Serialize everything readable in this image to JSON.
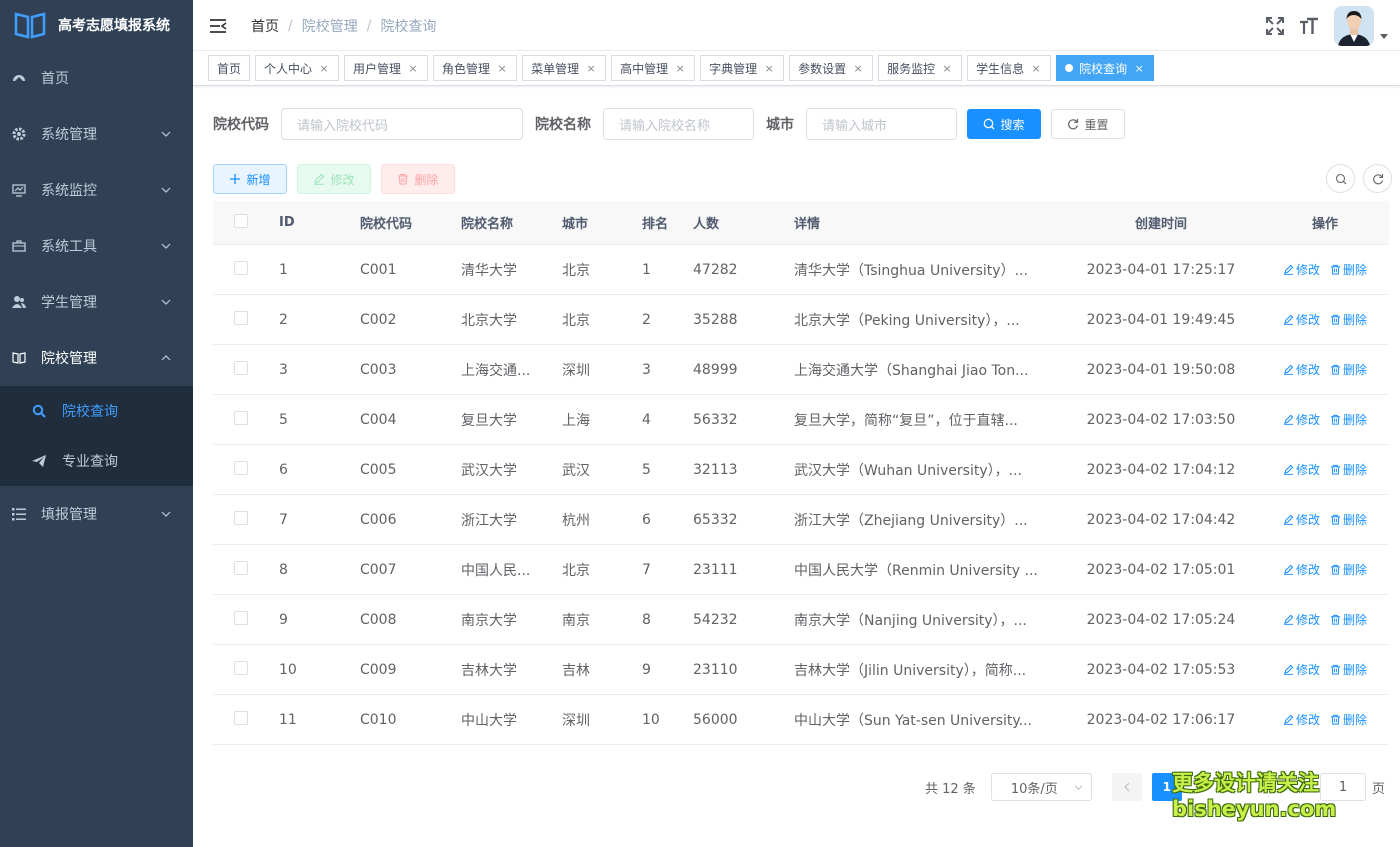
{
  "app": {
    "title": "高考志愿填报系统"
  },
  "sidebar": {
    "items": [
      {
        "label": "首页",
        "icon": "dashboard-icon"
      },
      {
        "label": "系统管理",
        "icon": "gear-icon"
      },
      {
        "label": "系统监控",
        "icon": "monitor-icon"
      },
      {
        "label": "系统工具",
        "icon": "toolbox-icon"
      },
      {
        "label": "学生管理",
        "icon": "people-icon"
      },
      {
        "label": "院校管理",
        "icon": "book-icon"
      },
      {
        "label": "填报管理",
        "icon": "list-icon"
      }
    ],
    "submenu": [
      {
        "label": "院校查询",
        "icon": "search-icon"
      },
      {
        "label": "专业查询",
        "icon": "send-icon"
      }
    ]
  },
  "navbar": {
    "breadcrumb": [
      "首页",
      "院校管理",
      "院校查询"
    ]
  },
  "tags": [
    {
      "label": "首页"
    },
    {
      "label": "个人中心"
    },
    {
      "label": "用户管理"
    },
    {
      "label": "角色管理"
    },
    {
      "label": "菜单管理"
    },
    {
      "label": "高中管理"
    },
    {
      "label": "字典管理"
    },
    {
      "label": "参数设置"
    },
    {
      "label": "服务监控"
    },
    {
      "label": "学生信息"
    },
    {
      "label": "院校查询"
    }
  ],
  "search": {
    "code_label": "院校代码",
    "code_placeholder": "请输入院校代码",
    "name_label": "院校名称",
    "name_placeholder": "请输入院校名称",
    "city_label": "城市",
    "city_placeholder": "请输入城市",
    "search_btn": "搜索",
    "reset_btn": "重置"
  },
  "toolbar": {
    "add": "新增",
    "edit": "修改",
    "delete": "删除"
  },
  "table": {
    "columns": [
      "ID",
      "院校代码",
      "院校名称",
      "城市",
      "排名",
      "人数",
      "详情",
      "创建时间",
      "操作"
    ],
    "op_edit": "修改",
    "op_delete": "删除",
    "rows": [
      {
        "id": "1",
        "code": "C001",
        "name": "清华大学",
        "city": "北京",
        "rank": "1",
        "count": "47282",
        "detail": "清华大学（Tsinghua University）...",
        "time": "2023-04-01 17:25:17"
      },
      {
        "id": "2",
        "code": "C002",
        "name": "北京大学",
        "city": "北京",
        "rank": "2",
        "count": "35288",
        "detail": "北京大学（Peking University），...",
        "time": "2023-04-01 19:49:45"
      },
      {
        "id": "3",
        "code": "C003",
        "name": "上海交通...",
        "city": "深圳",
        "rank": "3",
        "count": "48999",
        "detail": "上海交通大学（Shanghai Jiao Ton...",
        "time": "2023-04-01 19:50:08"
      },
      {
        "id": "5",
        "code": "C004",
        "name": "复旦大学",
        "city": "上海",
        "rank": "4",
        "count": "56332",
        "detail": "复旦大学，简称“复旦”，位于直辖...",
        "time": "2023-04-02 17:03:50"
      },
      {
        "id": "6",
        "code": "C005",
        "name": "武汉大学",
        "city": "武汉",
        "rank": "5",
        "count": "32113",
        "detail": "武汉大学（Wuhan University），...",
        "time": "2023-04-02 17:04:12"
      },
      {
        "id": "7",
        "code": "C006",
        "name": "浙江大学",
        "city": "杭州",
        "rank": "6",
        "count": "65332",
        "detail": "浙江大学（Zhejiang University）...",
        "time": "2023-04-02 17:04:42"
      },
      {
        "id": "8",
        "code": "C007",
        "name": "中国人民...",
        "city": "北京",
        "rank": "7",
        "count": "23111",
        "detail": "中国人民大学（Renmin University ...",
        "time": "2023-04-02 17:05:01"
      },
      {
        "id": "9",
        "code": "C008",
        "name": "南京大学",
        "city": "南京",
        "rank": "8",
        "count": "54232",
        "detail": "南京大学（Nanjing University），...",
        "time": "2023-04-02 17:05:24"
      },
      {
        "id": "10",
        "code": "C009",
        "name": "吉林大学",
        "city": "吉林",
        "rank": "9",
        "count": "23110",
        "detail": "吉林大学（Jilin University），简称...",
        "time": "2023-04-02 17:05:53"
      },
      {
        "id": "11",
        "code": "C010",
        "name": "中山大学",
        "city": "深圳",
        "rank": "10",
        "count": "56000",
        "detail": "中山大学（Sun Yat-sen University...",
        "time": "2023-04-02 17:06:17"
      }
    ]
  },
  "pagination": {
    "total": "共 12 条",
    "page_size": "10条/页",
    "current": "1",
    "goto_value": "1",
    "goto_suffix": "页"
  },
  "watermark": {
    "line1": "更多设计请关注",
    "line2": "bisheyun.com"
  },
  "colors": {
    "sidebar_bg": "#304156",
    "submenu_bg": "#1f2d3d",
    "primary": "#1890ff",
    "active_tag": "#42a5f5"
  }
}
